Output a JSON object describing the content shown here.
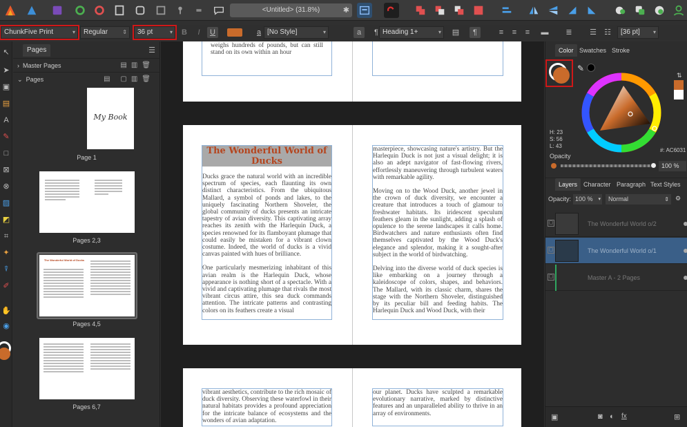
{
  "toolbar": {
    "document_title": "<Untitled> (31.8%)"
  },
  "context_bar": {
    "font_family": "ChunkFive Print",
    "font_style": "Regular",
    "font_size": "36 pt",
    "char_style": "[No Style]",
    "paragraph_style": "Heading 1+",
    "leading": "[36 pt]",
    "bold_label": "B",
    "italic_label": "I",
    "underline_label": "U",
    "text_color_hex": "#c96b2b"
  },
  "pages_panel": {
    "tab_label": "Pages",
    "master_pages_label": "Master Pages",
    "pages_label": "Pages",
    "thumbnails": [
      {
        "label": "Page 1",
        "cover_text": "My Book"
      },
      {
        "label": "Pages 2,3"
      },
      {
        "label": "Pages 4,5",
        "mini_title": "The Wonderful World of Ducks"
      },
      {
        "label": "Pages 6,7"
      }
    ]
  },
  "canvas": {
    "top_spread_text": "weighs hundreds of pounds, but can still stand on its own within an hour",
    "main_left_title": "The Wonderful World of Ducks",
    "main_left_paragraphs": [
      "Ducks grace the natural world with an incredible spectrum of species, each flaunting its own distinct characteristics. From the ubiquitous Mallard, a symbol of ponds and lakes, to the uniquely fascinating Northern Shoveler, the global community of ducks presents an intricate tapestry of avian diversity. This captivating array reaches its zenith with the Harlequin Duck, a species renowned for its flamboyant plumage that could easily be mistaken for a vibrant clown costume. Indeed, the world of ducks is a vivid canvas painted with hues of brilliance.",
      "One particularly mesmerizing inhabitant of this avian realm is the Harlequin Duck, whose appearance is nothing short of a spectacle. With a vivid and captivating plumage that rivals the most vibrant circus attire, this sea duck commands attention. The intricate patterns and contrasting colors on its feathers create a visual"
    ],
    "main_right_paragraphs": [
      "masterpiece, showcasing nature's artistry. But the Harlequin Duck is not just a visual delight; it is also an adept navigator of fast-flowing rivers, effortlessly maneuvering through turbulent waters with remarkable agility.",
      "Moving on to the Wood Duck, another jewel in the crown of duck diversity, we encounter a creature that introduces a touch of glamour to freshwater habitats. Its iridescent speculum feathers gleam in the sunlight, adding a splash of opulence to the serene landscapes it calls home. Birdwatchers and nature enthusiasts often find themselves captivated by the Wood Duck's elegance and splendor, making it a sought-after subject in the world of birdwatching.",
      "Delving into the diverse world of duck species is like embarking on a journey through a kaleidoscope of colors, shapes, and behaviors. The Mallard, with its classic charm, shares the stage with the Northern Shoveler, distinguished by its peculiar bill and feeding habits. The Harlequin Duck and Wood Duck, with their"
    ],
    "bottom_left_text": "vibrant aesthetics, contribute to the rich mosaic of duck diversity. Observing these waterfowl in their natural habitats provides a profound appreciation for the intricate balance of ecosystems and the wonders of avian adaptation.",
    "bottom_right_text": "our planet. Ducks have sculpted a remarkable evolutionary narrative, marked by distinctive features and an unparalleled ability to thrive in an array of environments."
  },
  "right_panel": {
    "tabs": [
      "Color",
      "Swatches",
      "Stroke"
    ],
    "hsl": {
      "h": "H: 23",
      "s": "S: 56",
      "l": "L: 43"
    },
    "hex_value": "#: AC6031",
    "opacity_label": "Opacity",
    "opacity_value": "100 %",
    "layer_tabs": [
      "Layers",
      "Character",
      "Paragraph",
      "Text Styles"
    ],
    "layer_opacity_label": "Opacity:",
    "layer_opacity_value": "100 %",
    "blend_mode": "Normal",
    "layers": [
      {
        "name": "The Wonderful World o/2",
        "selected": false
      },
      {
        "name": "The Wonderful World o/1",
        "selected": true
      },
      {
        "name": "Master A - 2 Pages",
        "selected": false
      }
    ],
    "accent_color": "#AC6031"
  }
}
